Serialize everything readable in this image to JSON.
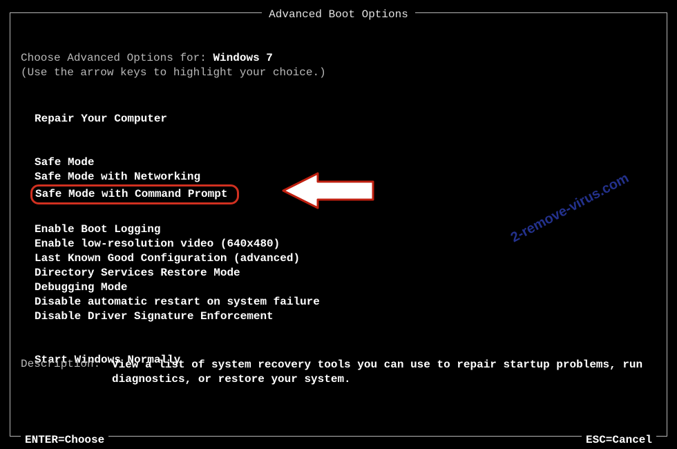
{
  "title": "Advanced Boot Options",
  "choose_prefix": "Choose Advanced Options for: ",
  "os_name": "Windows 7",
  "hint": "(Use the arrow keys to highlight your choice.)",
  "groups": {
    "repair": [
      "Repair Your Computer"
    ],
    "safe": [
      "Safe Mode",
      "Safe Mode with Networking",
      "Safe Mode with Command Prompt"
    ],
    "advanced": [
      "Enable Boot Logging",
      "Enable low-resolution video (640x480)",
      "Last Known Good Configuration (advanced)",
      "Directory Services Restore Mode",
      "Debugging Mode",
      "Disable automatic restart on system failure",
      "Disable Driver Signature Enforcement"
    ],
    "normal": [
      "Start Windows Normally"
    ]
  },
  "description": {
    "label": "Description:",
    "text": "View a list of system recovery tools you can use to repair startup problems, run diagnostics, or restore your system."
  },
  "footer": {
    "left": "ENTER=Choose",
    "right": "ESC=Cancel"
  },
  "watermark": "2-remove-virus.com"
}
